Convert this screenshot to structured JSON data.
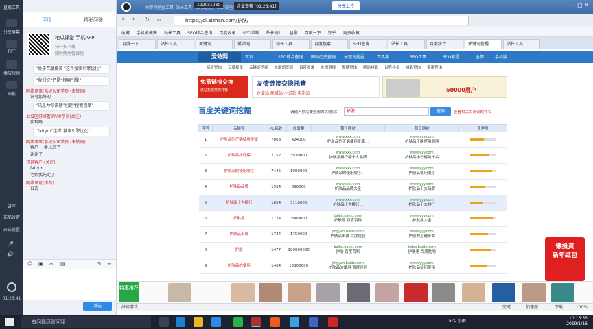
{
  "left_strip": {
    "title": "直播工具",
    "items": [
      "分享屏幕",
      "PPT",
      "播放视频",
      "画板"
    ],
    "bottom_items": [
      "讲座",
      "布局设置",
      "开启设置"
    ],
    "time": "01:23:41"
  },
  "chat": {
    "tabs": [
      "评论",
      "精彩问答"
    ],
    "promo_title": "地瓜课堂 手机APP",
    "promo_sub": "扫一扫下载",
    "promo_sub2": "随时随地看课程",
    "messages": [
      {
        "type": "bubble",
        "text": "“关于百度排名 ”这个搜索引擎优化”"
      },
      {
        "type": "bubble",
        "text": "“我们说”仍是“搜索引擎”"
      },
      {
        "type": "name",
        "text": "网络讯事(系统)VIP学员 (未转码)"
      },
      {
        "type": "plain",
        "text": "许可您好的"
      },
      {
        "type": "bubble",
        "text": "“讯息为你讯息”也是“搜索引擎”"
      },
      {
        "type": "name",
        "text": "上城区好好看的VIP学员(关注)"
      },
      {
        "type": "plain",
        "text": "实现吗"
      },
      {
        "type": "bubble",
        "text": "“fairym”这样“搜索引擎优化”"
      },
      {
        "type": "name",
        "text": "网络讯事(系统)VIP学员 (未转码)"
      },
      {
        "type": "plain",
        "text": "客户 一会儿来了"
      },
      {
        "type": "plain",
        "text": "谢谢了"
      },
      {
        "type": "name",
        "text": "讯息客户 (关注)"
      },
      {
        "type": "plain",
        "text": "fairym"
      },
      {
        "type": "plain",
        "text": "老师我先走了"
      },
      {
        "type": "name",
        "text": "网络讯息(推荐)"
      },
      {
        "type": "plain",
        "text": "公式"
      }
    ],
    "send_label": "发送"
  },
  "browser": {
    "title": "关键词挖掘工具_站长工具 - 站长之家 - 360安全浏览器",
    "title_badge": "1920x1080",
    "tab_counter": "企业审核 [01:23:41]",
    "top_btn": "分享上传",
    "url": "https://ci.aizhan.com/护肤/",
    "bookmarks": [
      "收藏",
      "手机收藏夹",
      "站长工具",
      "SEO综合查询",
      "百度收录",
      "SEO诊断",
      "站长统计",
      "谷歌",
      "百度一下",
      "知乎",
      "更多收藏"
    ],
    "tabs": [
      "百度一下",
      "站长工具",
      "关键词",
      "爱站网",
      "站长工具",
      "百度搜索",
      "SEO查询",
      "站长工具",
      "百度统计",
      "关键词挖掘",
      "站长工具"
    ],
    "active_tab": 9
  },
  "site": {
    "logo": "爱站网",
    "nav": [
      "首页",
      "SEO综合查询",
      "网站历史查询",
      "关键词挖掘",
      "工具集",
      "SEO工具",
      "SEO教程",
      "全部",
      "手机版"
    ],
    "subnav": [
      "综合查询",
      "百度权重",
      "关键词挖掘",
      "长尾词挖掘",
      "百度收录",
      "友情链接",
      "反链查询",
      "网站排名",
      "世界排名",
      "域名查询",
      "备案查询"
    ],
    "ad1": "免费链接交换",
    "ad1_sub": "爱站友链交换托管",
    "ad2": "友情链接交换托管",
    "ad2_sub": "企业站 商城站 小说站 电影站",
    "ad3": "60000用户",
    "page_title": "百度关键词挖掘",
    "query_label": "请输入你需要查询的关键词：",
    "query_value": "护肤",
    "query_button": "查询",
    "query_link": "查看相关关键词的排名"
  },
  "table": {
    "headers": [
      "序号",
      "关键词",
      "PC指数",
      "收录量",
      "首位网址",
      "首页网址",
      "竞争度"
    ],
    "rows": [
      {
        "n": "1",
        "kw": "护肤品的正确使用步骤",
        "pc": "7863",
        "sl": "424000",
        "u1": "www.xxx.com",
        "d1": "护肤品的正确使用步骤...",
        "u2": "www.yyy.com",
        "d2": "护肤品正确使用顺序",
        "lvl": 0.55
      },
      {
        "n": "2",
        "kw": "护肤品排行榜",
        "pc": "2152",
        "sl": "3930000",
        "u1": "www.xxx.com",
        "d1": "护肤品排行榜十大品牌",
        "u2": "www.yyy.com",
        "d2": "护肤品排行榜前十名",
        "lvl": 0.75
      },
      {
        "n": "3",
        "kw": "护肤品的使用顺序",
        "pc": "7445",
        "sl": "1000000",
        "u1": "www.xxx.com",
        "d1": "护肤品的使用顺序...",
        "u2": "www.yyy.com",
        "d2": "护肤品使用顺序",
        "lvl": 0.85
      },
      {
        "n": "4",
        "kw": "护肤品品牌",
        "pc": "1554",
        "sb": "",
        "sl": "396000",
        "u1": "www.xxx.com",
        "d1": "护肤品品牌大全",
        "u2": "www.yyy.com",
        "d2": "护肤品十大品牌",
        "lvl": 0.6
      },
      {
        "n": "5",
        "kw": "护肤品十大排行",
        "pc": "1654",
        "sl": "3110000",
        "u1": "www.xxx.com",
        "d1": "护肤品十大排行...",
        "u2": "www.yyy.com",
        "d2": "护肤品十大排行",
        "lvl": 0.5
      },
      {
        "n": "6",
        "kw": "护肤品",
        "pc": "1774",
        "sl": "3000000",
        "u1": "baike.baidu.com",
        "d1": "护肤品 百度百科",
        "u2": "www.yyy.com",
        "d2": "护肤品大全",
        "lvl": 0.9
      },
      {
        "n": "7",
        "kw": "护肤品步骤",
        "pc": "1724",
        "sl": "1750000",
        "u1": "jingyan.baidu.com",
        "d1": "护肤品步骤 百度经验",
        "u2": "www.yyy.com",
        "d2": "护肤的正确步骤",
        "lvl": 0.7
      },
      {
        "n": "8",
        "kw": "护肤",
        "pc": "1477",
        "sl": "100000000",
        "u1": "baike.baidu.com",
        "d1": "护肤 百度百科",
        "u2": "tieba.baidu.com",
        "d2": "护肤吧 百度贴吧",
        "lvl": 0.8
      },
      {
        "n": "9",
        "kw": "护肤品的使用",
        "pc": "1464",
        "sl": "15300000",
        "u1": "jingyan.baidu.com",
        "d1": "护肤品的使用 百度经验",
        "u2": "www.yyy.com",
        "d2": "护肤品如何使用",
        "lvl": 0.65
      }
    ]
  },
  "redad": {
    "line1": "懒投资",
    "line2": "新年红包"
  },
  "greenbox": "特惠推荐",
  "status": {
    "left": "好德游戏",
    "right_items": [
      "完成",
      "加速器",
      "下载",
      "100%"
    ]
  },
  "taskbar": {
    "search": "有问题尽管问我",
    "clock_time": "10:15:53",
    "clock_date": "2019/1/16",
    "weather": "5°C 小雨"
  }
}
